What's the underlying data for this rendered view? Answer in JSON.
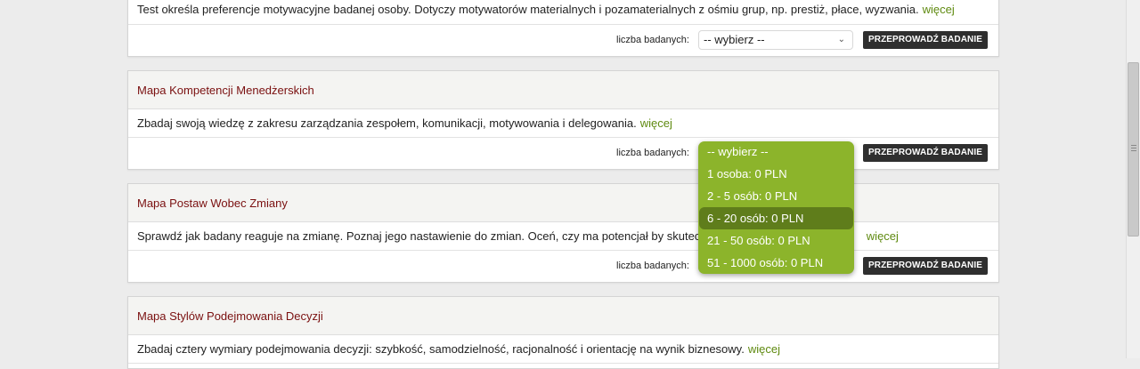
{
  "cards": [
    {
      "description": "Test określa preferencje motywacyjne badanej osoby. Dotyczy motywatorów materialnych i pozamaterialnych z ośmiu grup, np. prestiż, płace, wyzwania.",
      "more": "więcej",
      "count_label": "liczba badanych:",
      "select_value": "-- wybierz --",
      "button": "PRZEPROWADŹ BADANIE"
    },
    {
      "title": "Mapa Kompetencji Menedżerskich",
      "description": "Zbadaj swoją wiedzę z zakresu zarządzania zespołem, komunikacji, motywowania i delegowania.",
      "more": "więcej",
      "count_label": "liczba badanych:",
      "button": "PRZEPROWADŹ BADANIE"
    },
    {
      "title": "Mapa Postaw Wobec Zmiany",
      "description": "Sprawdź jak badany reaguje na zmianę. Poznaj jego nastawienie do zmian. Oceń, czy ma potencjał by skutecz",
      "more": "więcej",
      "count_label": "liczba badanych:",
      "button": "PRZEPROWADŹ BADANIE"
    },
    {
      "title": "Mapa Stylów Podejmowania Decyzji",
      "description": "Zbadaj cztery wymiary podejmowania decyzji: szybkość, samodzielność, racjonalność i  orientację na wynik biznesowy.",
      "more": "więcej"
    }
  ],
  "dropdown": {
    "options": [
      "-- wybierz --",
      "1 osoba: 0 PLN",
      "2 - 5 osób: 0 PLN",
      "6 - 20 osób: 0 PLN",
      "21 - 50 osób: 0 PLN",
      "51 - 1000 osób: 0 PLN"
    ],
    "highlighted_index": 3
  },
  "colors": {
    "title": "#7a1010",
    "link": "#5f8a10",
    "dropdown_bg": "#8cb42b",
    "dropdown_highlight": "#5f7d1b",
    "button_bg": "#2f2f2f"
  }
}
